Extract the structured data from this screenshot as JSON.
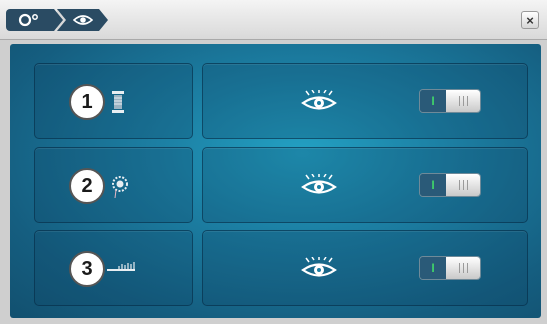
{
  "titlebar": {
    "breadcrumbs": [
      {
        "icon": "settings-icon"
      },
      {
        "icon": "eye-icon"
      }
    ],
    "close_icon": "close-icon",
    "close_label": "×"
  },
  "colors": {
    "panel_center": "#23a1c3",
    "panel_edge": "#12506f",
    "toggle_on_indicator": "#3fd36a",
    "breadcrumb_bg": "#2a4b63"
  },
  "rows": [
    {
      "number": "1",
      "tool_icon": "thread-spool-icon",
      "visibility_icon": "eye-icon",
      "toggle_on_label": "I",
      "toggle_state": "on"
    },
    {
      "number": "2",
      "tool_icon": "tension-dial-icon",
      "visibility_icon": "eye-icon",
      "toggle_on_label": "I",
      "toggle_state": "on"
    },
    {
      "number": "3",
      "tool_icon": "stitch-length-icon",
      "visibility_icon": "eye-icon",
      "toggle_on_label": "I",
      "toggle_state": "on"
    }
  ]
}
